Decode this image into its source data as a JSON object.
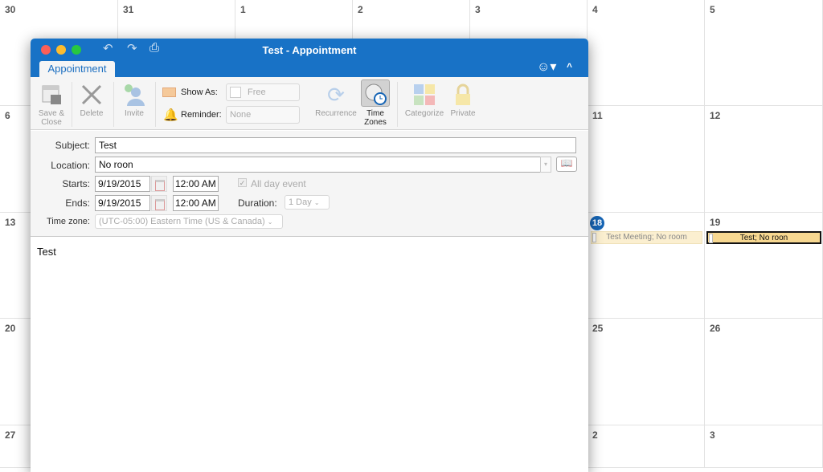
{
  "calendar": {
    "rows": [
      [
        "30",
        "31",
        "1",
        "2",
        "3",
        "4",
        "5"
      ],
      [
        "6",
        "",
        "",
        "",
        "",
        "11",
        "12"
      ],
      [
        "13",
        "",
        "",
        "",
        "",
        "18",
        "19"
      ],
      [
        "20",
        "",
        "",
        "",
        "",
        "25",
        "26"
      ],
      [
        "27",
        "",
        "",
        "",
        "",
        "2",
        "3"
      ]
    ],
    "today": "18",
    "events": [
      {
        "label": "Test Meeting; No room"
      },
      {
        "label": "Test; No roon"
      }
    ]
  },
  "window": {
    "title": "Test - Appointment",
    "tab": "Appointment",
    "toolbar": {
      "save_close": "Save &\nClose",
      "delete": "Delete",
      "invite": "Invite",
      "show_as_label": "Show As:",
      "show_as_value": "Free",
      "reminder_label": "Reminder:",
      "reminder_value": "None",
      "recurrence": "Recurrence",
      "time_zones": "Time\nZones",
      "categorize": "Categorize",
      "private": "Private"
    },
    "form": {
      "subject_label": "Subject:",
      "subject": "Test",
      "location_label": "Location:",
      "location": "No roon",
      "starts_label": "Starts:",
      "start_date": "9/19/2015",
      "start_time": "12:00 AM",
      "all_day": "All day event",
      "ends_label": "Ends:",
      "end_date": "9/19/2015",
      "end_time": "12:00 AM",
      "duration_label": "Duration:",
      "duration": "1 Day",
      "timezone_label": "Time zone:",
      "timezone": "(UTC-05:00) Eastern Time (US & Canada)"
    },
    "body": "Test"
  },
  "colors": {
    "titlebar": "#1872c6",
    "today": "#1665b5",
    "event": "#f7d891"
  }
}
